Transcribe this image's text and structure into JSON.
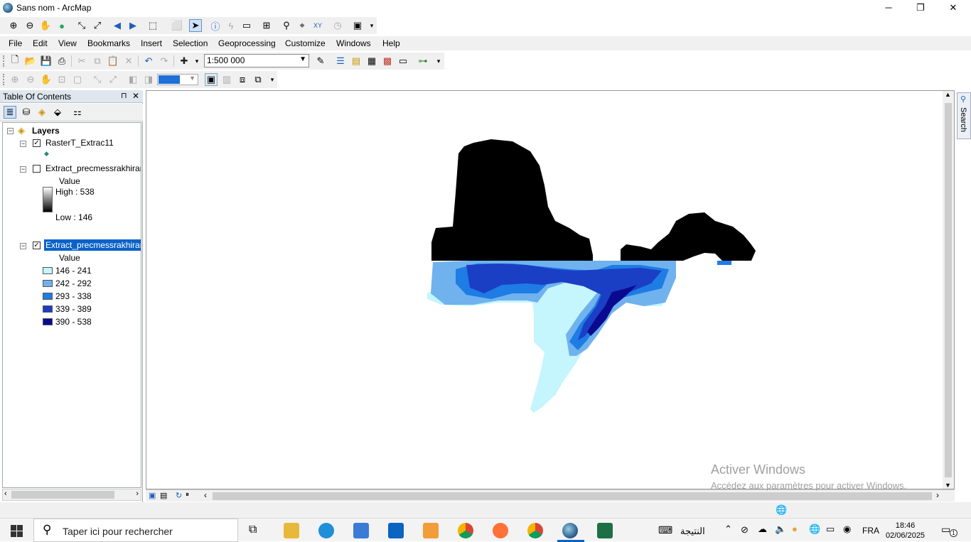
{
  "window": {
    "title": "Sans nom - ArcMap",
    "minimize": "─",
    "restore": "❐",
    "close": "✕"
  },
  "menubar": {
    "items": [
      "File",
      "Edit",
      "View",
      "Bookmarks",
      "Insert",
      "Selection",
      "Geoprocessing",
      "Customize",
      "Windows",
      "Help"
    ]
  },
  "standard_toolbar": {
    "scale": "1:500 000"
  },
  "toc": {
    "title": "Table Of Contents",
    "pin": "⊓",
    "close": "✕",
    "root_label": "Layers",
    "layer1": {
      "name": "RasterT_Extrac11",
      "checked": true
    },
    "layer2": {
      "name": "Extract_precmessrakhiran",
      "checked": false,
      "value_label": "Value",
      "high": "High : 538",
      "low": "Low : 146"
    },
    "layer3": {
      "name": "Extract_precmessrakhiran",
      "checked": true,
      "value_label": "Value",
      "classes": [
        {
          "label": "146 - 241",
          "color": "#c5f5fd"
        },
        {
          "label": "242 - 292",
          "color": "#6fb2ee"
        },
        {
          "label": "293 - 338",
          "color": "#1e7ce4"
        },
        {
          "label": "339 - 389",
          "color": "#1a3fc4"
        },
        {
          "label": "390 - 538",
          "color": "#0a0a90"
        }
      ]
    }
  },
  "map": {
    "colors": {
      "class1": "#c5f5fd",
      "class2": "#6fb2ee",
      "class3": "#1e7ce4",
      "class4": "#1a3fc4",
      "class5": "#0a0a90",
      "polygon": "#000000"
    }
  },
  "side_panel": {
    "search_label": "Search"
  },
  "activation_watermark": {
    "line1": "Activer Windows",
    "line2": "Accédez aux paramètres pour activer Windows."
  },
  "taskbar": {
    "search_placeholder": "Taper ici pour rechercher",
    "result_label": "النتيجة",
    "language": "FRA",
    "time": "18:46",
    "date": "02/06/2025",
    "notification_count": "1"
  }
}
